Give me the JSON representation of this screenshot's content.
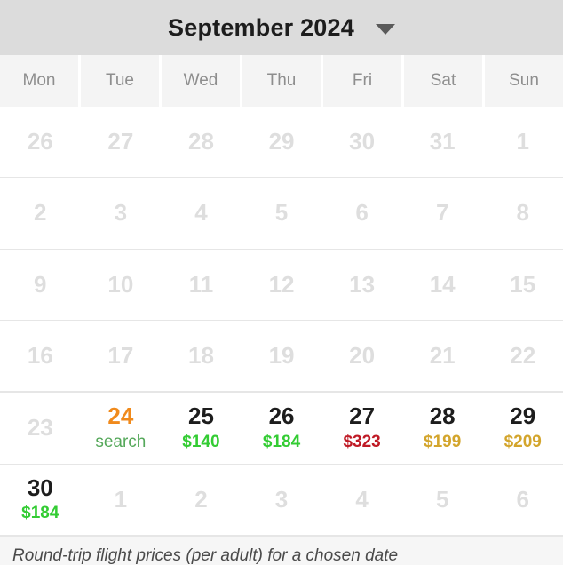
{
  "header": {
    "month_title": "September 2024",
    "dropdown_icon": "chevron-down-icon"
  },
  "weekdays": [
    {
      "label": "Mon"
    },
    {
      "label": "Tue"
    },
    {
      "label": "Wed"
    },
    {
      "label": "Thu"
    },
    {
      "label": "Fri"
    },
    {
      "label": "Sat"
    },
    {
      "label": "Sun"
    }
  ],
  "weeks": [
    {
      "days": [
        {
          "number": "26",
          "muted": true,
          "price": "",
          "price_color": ""
        },
        {
          "number": "27",
          "muted": true,
          "price": "",
          "price_color": ""
        },
        {
          "number": "28",
          "muted": true,
          "price": "",
          "price_color": ""
        },
        {
          "number": "29",
          "muted": true,
          "price": "",
          "price_color": ""
        },
        {
          "number": "30",
          "muted": true,
          "price": "",
          "price_color": ""
        },
        {
          "number": "31",
          "muted": true,
          "price": "",
          "price_color": ""
        },
        {
          "number": "1",
          "muted": true,
          "price": "",
          "price_color": ""
        }
      ]
    },
    {
      "days": [
        {
          "number": "2",
          "muted": true,
          "price": "",
          "price_color": ""
        },
        {
          "number": "3",
          "muted": true,
          "price": "",
          "price_color": ""
        },
        {
          "number": "4",
          "muted": true,
          "price": "",
          "price_color": ""
        },
        {
          "number": "5",
          "muted": true,
          "price": "",
          "price_color": ""
        },
        {
          "number": "6",
          "muted": true,
          "price": "",
          "price_color": ""
        },
        {
          "number": "7",
          "muted": true,
          "price": "",
          "price_color": ""
        },
        {
          "number": "8",
          "muted": true,
          "price": "",
          "price_color": ""
        }
      ]
    },
    {
      "days": [
        {
          "number": "9",
          "muted": true,
          "price": "",
          "price_color": ""
        },
        {
          "number": "10",
          "muted": true,
          "price": "",
          "price_color": ""
        },
        {
          "number": "11",
          "muted": true,
          "price": "",
          "price_color": ""
        },
        {
          "number": "12",
          "muted": true,
          "price": "",
          "price_color": ""
        },
        {
          "number": "13",
          "muted": true,
          "price": "",
          "price_color": ""
        },
        {
          "number": "14",
          "muted": true,
          "price": "",
          "price_color": ""
        },
        {
          "number": "15",
          "muted": true,
          "price": "",
          "price_color": ""
        }
      ]
    },
    {
      "days": [
        {
          "number": "16",
          "muted": true,
          "price": "",
          "price_color": ""
        },
        {
          "number": "17",
          "muted": true,
          "price": "",
          "price_color": ""
        },
        {
          "number": "18",
          "muted": true,
          "price": "",
          "price_color": ""
        },
        {
          "number": "19",
          "muted": true,
          "price": "",
          "price_color": ""
        },
        {
          "number": "20",
          "muted": true,
          "price": "",
          "price_color": ""
        },
        {
          "number": "21",
          "muted": true,
          "price": "",
          "price_color": ""
        },
        {
          "number": "22",
          "muted": true,
          "price": "",
          "price_color": ""
        }
      ]
    },
    {
      "is_price_row": true,
      "days": [
        {
          "number": "23",
          "muted": true,
          "price": "",
          "price_color": ""
        },
        {
          "number": "24",
          "muted": false,
          "accent": "orange",
          "price": "search",
          "price_color": "search"
        },
        {
          "number": "25",
          "muted": false,
          "price": "$140",
          "price_color": "green"
        },
        {
          "number": "26",
          "muted": false,
          "price": "$184",
          "price_color": "green"
        },
        {
          "number": "27",
          "muted": false,
          "price": "$323",
          "price_color": "red"
        },
        {
          "number": "28",
          "muted": false,
          "price": "$199",
          "price_color": "amber"
        },
        {
          "number": "29",
          "muted": false,
          "price": "$209",
          "price_color": "amber"
        }
      ]
    },
    {
      "days": [
        {
          "number": "30",
          "muted": false,
          "price": "$184",
          "price_color": "green"
        },
        {
          "number": "1",
          "muted": true,
          "price": "",
          "price_color": ""
        },
        {
          "number": "2",
          "muted": true,
          "price": "",
          "price_color": ""
        },
        {
          "number": "3",
          "muted": true,
          "price": "",
          "price_color": ""
        },
        {
          "number": "4",
          "muted": true,
          "price": "",
          "price_color": ""
        },
        {
          "number": "5",
          "muted": true,
          "price": "",
          "price_color": ""
        },
        {
          "number": "6",
          "muted": true,
          "price": "",
          "price_color": ""
        }
      ]
    }
  ],
  "footer": {
    "note": "Round-trip flight prices (per adult) for a chosen date"
  },
  "colors": {
    "header_bg": "#dcdcdc",
    "weekday_bg": "#f4f4f4",
    "muted_date": "#dedede",
    "selected_date": "#f08a1c",
    "price_green": "#33cc33",
    "price_red": "#bf1a25",
    "price_amber": "#d3a52c",
    "search_green": "#55a85a"
  }
}
